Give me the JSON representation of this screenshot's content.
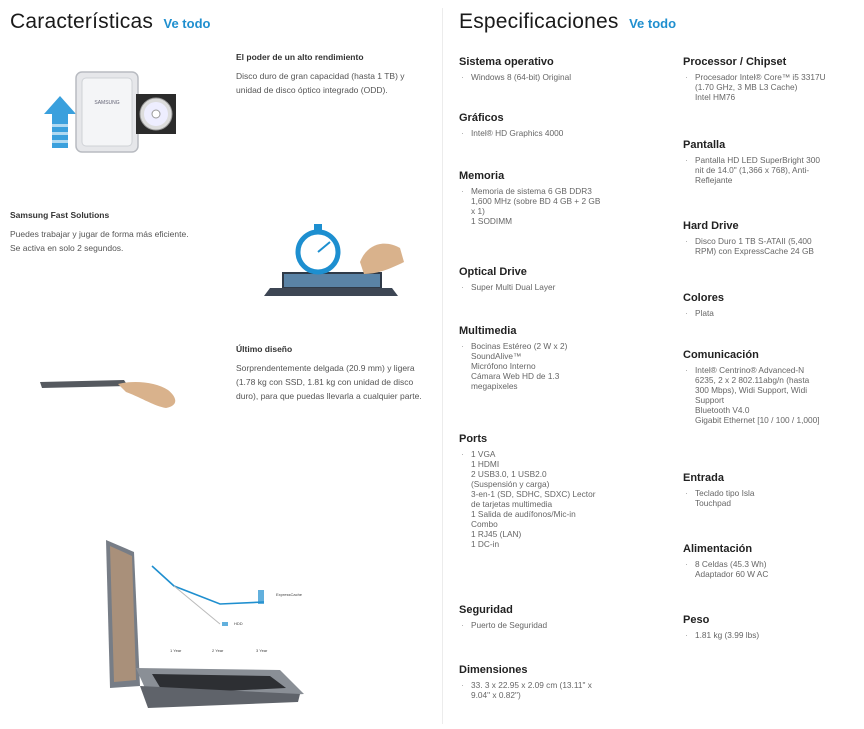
{
  "features": {
    "title": "Características",
    "view_all": "Ve todo",
    "items": [
      {
        "title": "El poder de un alto rendimiento",
        "desc": "Disco duro de gran capacidad (hasta 1 TB) y unidad de disco óptico integrado (ODD)."
      },
      {
        "title": "Samsung Fast Solutions",
        "desc": "Puedes trabajar y jugar de forma más eficiente. Se activa en solo 2 segundos."
      },
      {
        "title": "Último diseño",
        "desc": "Sorprendentemente delgada (20.9 mm) y ligera (1.78 kg con SSD, 1.81 kg con unidad de disco duro), para que puedas llevarla a cualquier parte."
      }
    ],
    "hdd_label": "SAMSUNG",
    "chart_labels": {
      "x1": "1 Year",
      "x2": "2 Year",
      "x3": "3 Year",
      "ssd": "ExpressCache",
      "hdd": "HDD"
    }
  },
  "specs": {
    "title": "Especificaciones",
    "view_all": "Ve todo",
    "left": [
      {
        "label": "Sistema operativo",
        "value": "Windows 8 (64-bit) Original"
      },
      {
        "label": "Gráficos",
        "value": "Intel® HD Graphics 4000"
      },
      {
        "label": "Memoria",
        "value": "Memoria de sistema 6 GB DDR3\n1,600 MHz (sobre BD 4 GB + 2 GB\nx 1)\n1 SODIMM"
      },
      {
        "label": "Optical Drive",
        "value": "Super Multi Dual Layer"
      },
      {
        "label": "Multimedia",
        "value": "Bocinas Estéreo (2 W x 2)\nSoundAlive™\nMicrófono Interno\nCámara Web HD de 1.3\nmegapixeles"
      },
      {
        "label": "Ports",
        "value": "1 VGA\n1 HDMI\n2 USB3.0, 1 USB2.0\n(Suspensión y carga)\n3-en-1 (SD, SDHC, SDXC) Lector\nde tarjetas multimedia\n1 Salida de audífonos/Mic-in\nCombo\n1 RJ45 (LAN)\n1 DC-in"
      },
      {
        "label": "Seguridad",
        "value": "Puerto de Seguridad"
      },
      {
        "label": "Dimensiones",
        "value": "33. 3 x 22.95 x 2.09 cm (13.11\" x\n9.04\" x 0.82\")"
      }
    ],
    "right": [
      {
        "label": "Processor / Chipset",
        "value": "Procesador Intel® Core™ i5 3317U\n(1.70 GHz, 3 MB L3 Cache)\nIntel HM76"
      },
      {
        "label": "Pantalla",
        "value": "Pantalla HD LED SuperBright 300\nnit de 14.0\" (1,366 x 768), Anti-\nReflejante"
      },
      {
        "label": "Hard Drive",
        "value": "Disco Duro 1 TB S-ATAII (5,400\nRPM) con ExpressCache 24 GB"
      },
      {
        "label": "Colores",
        "value": "Plata"
      },
      {
        "label": "Comunicación",
        "value": "Intel® Centrino® Advanced-N\n6235, 2 x 2 802.11abg/n (hasta\n300 Mbps), Widi Support, Widi\nSupport\nBluetooth V4.0\nGigabit Ethernet [10 / 100 / 1,000]"
      },
      {
        "label": "Entrada",
        "value": "Teclado tipo Isla\nTouchpad"
      },
      {
        "label": "Alimentación",
        "value": "8 Celdas (45.3 Wh)\nAdaptador 60 W AC"
      },
      {
        "label": "Peso",
        "value": "1.81 kg (3.99 lbs)"
      }
    ]
  },
  "colors": {
    "accent": "#1f8fcf",
    "arrow": "#3aa0dd"
  }
}
